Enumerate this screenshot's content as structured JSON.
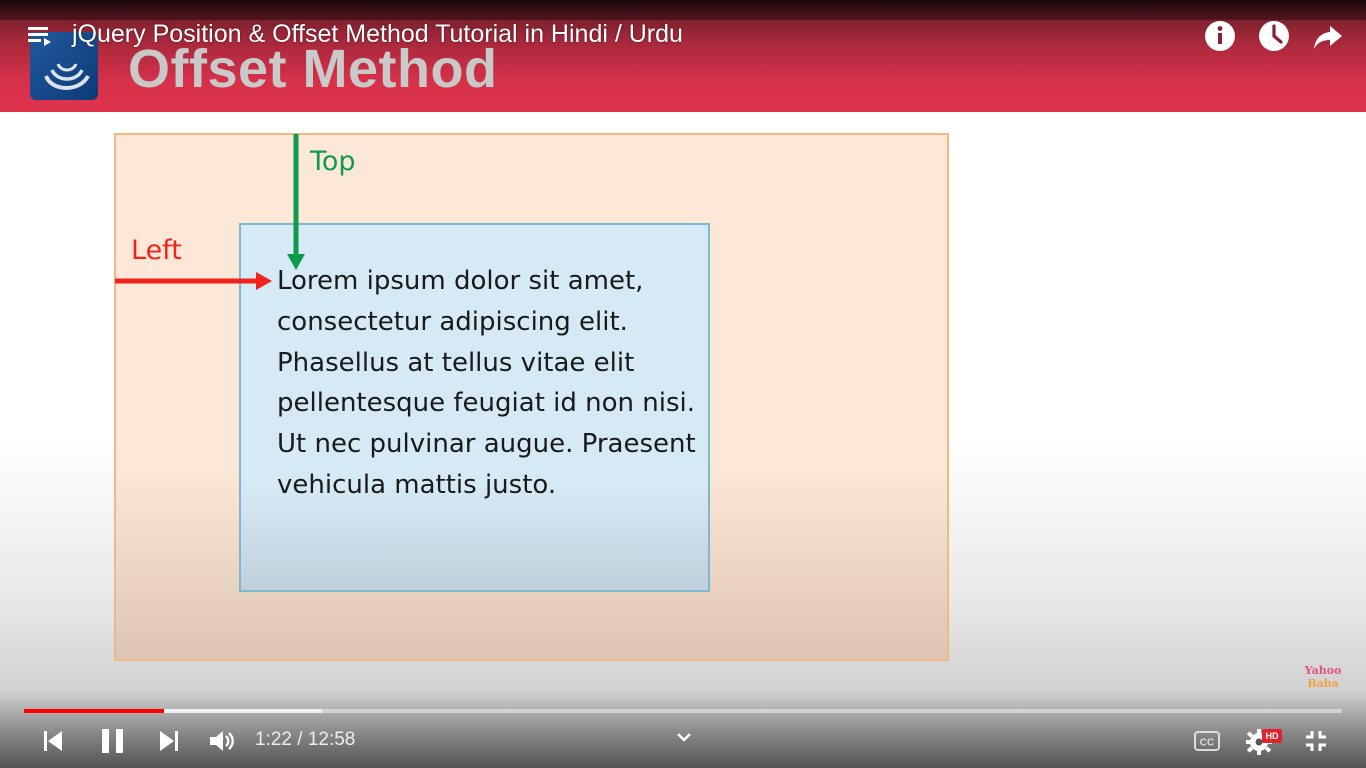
{
  "video": {
    "title": "jQuery Position & Offset Method Tutorial in Hindi / Urdu"
  },
  "slide": {
    "heading": "Offset Method",
    "label_top": "Top",
    "label_left": "Left",
    "paragraph": "Lorem ipsum dolor sit amet, consectetur adipiscing elit. Phasellus at tellus vitae elit pellentesque feugiat id non nisi. Ut nec pulvinar augue. Praesent vehicula mattis justo.",
    "watermark_line1": "Yahoo",
    "watermark_line2": "Baba"
  },
  "player": {
    "current_time": "1:22",
    "separator": " / ",
    "duration": "12:58",
    "progress_fraction": 0.106,
    "buffered_fraction": 0.226,
    "hd_badge": "HD",
    "played_color": "#ff0000"
  },
  "colors": {
    "header_red": "#e0344c",
    "top_arrow": "#0f9a4e",
    "left_arrow": "#f2231c",
    "outer_border": "#f2b880",
    "inner_border": "#7db7d0"
  },
  "icons": {
    "playlist": "playlist-icon",
    "info": "info-icon",
    "watch_later": "clock-icon",
    "share": "share-icon",
    "previous": "skip-previous-icon",
    "pause": "pause-icon",
    "next": "skip-next-icon",
    "volume": "volume-icon",
    "chevron": "chevron-down-icon",
    "captions": "captions-icon",
    "settings": "settings-gear-icon",
    "exit_fullscreen": "exit-fullscreen-icon"
  }
}
